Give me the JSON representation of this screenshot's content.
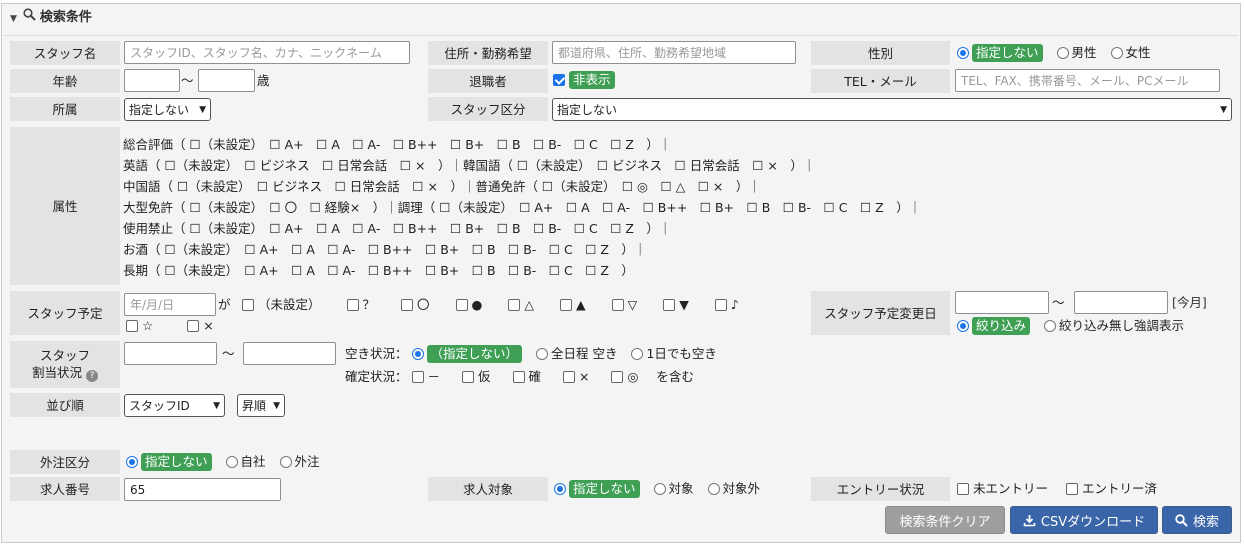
{
  "panel": {
    "title": "検索条件"
  },
  "row1": {
    "staff_name_label": "スタッフ名",
    "staff_name_placeholder": "スタッフID、スタッフ名、カナ、ニックネーム",
    "address_label": "住所・勤務希望",
    "address_placeholder": "都道府県、住所、勤務希望地域",
    "gender_label": "性別",
    "gender_options": [
      "指定しない",
      "男性",
      "女性"
    ]
  },
  "row2": {
    "age_label": "年齢",
    "age_sep": "～",
    "age_unit": "歳",
    "retired_label": "退職者",
    "retired_value": "非表示",
    "contact_label": "TEL・メール",
    "contact_placeholder": "TEL、FAX、携帯番号、メール、PCメール"
  },
  "row3": {
    "dept_label": "所属",
    "dept_value": "指定しない",
    "staff_type_label": "スタッフ区分",
    "staff_type_value": "指定しない"
  },
  "attributes": {
    "label": "属性",
    "lines": [
      "総合評価（ ☐（未設定）　☐ A+　☐ A　☐ A-　☐ B++　☐ B+　☐ B　☐ B-　☐ C　☐ Z　）｜",
      "英語（ ☐（未設定）　☐ ビジネス　☐ 日常会話　☐ ×　）｜韓国語（ ☐（未設定）　☐ ビジネス　☐ 日常会話　☐ ×　）｜",
      "中国語（ ☐（未設定）　☐ ビジネス　☐ 日常会話　☐ ×　）｜普通免許（ ☐（未設定）　☐ ◎　☐ △　☐ ×　）｜",
      "大型免許（ ☐（未設定）　☐ 〇　☐ 経験×　）｜調理（ ☐（未設定）　☐ A+　☐ A　☐ A-　☐ B++　☐ B+　☐ B　☐ B-　☐ C　☐ Z　）｜",
      "使用禁止（ ☐（未設定）　☐ A+　☐ A　☐ A-　☐ B++　☐ B+　☐ B　☐ B-　☐ C　☐ Z　）｜",
      "お酒（ ☐（未設定）　☐ A+　☐ A　☐ A-　☐ B++　☐ B+　☐ B　☐ B-　☐ C　☐ Z　）｜",
      "長期（ ☐（未設定）　☐ A+　☐ A　☐ A-　☐ B++　☐ B+　☐ B　☐ B-　☐ C　☐ Z　）"
    ]
  },
  "schedule": {
    "label": "スタッフ予定",
    "date_placeholder": "年/月/日",
    "ga": "が",
    "options": [
      "（未設定）",
      "？",
      "〇",
      "●",
      "△",
      "▲",
      "▽",
      "▼",
      "♪",
      "☆",
      "×"
    ],
    "change_label": "スタッフ予定変更日",
    "change_sep": "～",
    "this_month": "[今月]",
    "filter_options": [
      "絞り込み",
      "絞り込み無し強調表示"
    ]
  },
  "assign": {
    "label1": "スタッフ",
    "label2": "割当状況",
    "sep": "～",
    "vacancy_label": "空き状況：",
    "vacancy_options": [
      "（指定しない）",
      "全日程 空き",
      "1日でも空き"
    ],
    "confirm_label": "確定状況：",
    "confirm_options": [
      "－",
      "仮",
      "確",
      "×",
      "◎"
    ],
    "confirm_suffix": "を含む"
  },
  "sort": {
    "label": "並び順",
    "field": "スタッフID",
    "order": "昇順"
  },
  "outsource": {
    "label": "外注区分",
    "options": [
      "指定しない",
      "自社",
      "外注"
    ]
  },
  "job": {
    "number_label": "求人番号",
    "number_value": "65",
    "target_label": "求人対象",
    "target_options": [
      "指定しない",
      "対象",
      "対象外"
    ],
    "entry_label": "エントリー状況",
    "entry_options": [
      "未エントリー",
      "エントリー済"
    ]
  },
  "buttons": {
    "clear": "検索条件クリア",
    "csv": "CSVダウンロード",
    "search": "検索"
  },
  "colors": {
    "accent": "#1a73e8",
    "badge": "#3fa055",
    "button": "#3a65a8",
    "clear_button": "#9e9e9e"
  }
}
